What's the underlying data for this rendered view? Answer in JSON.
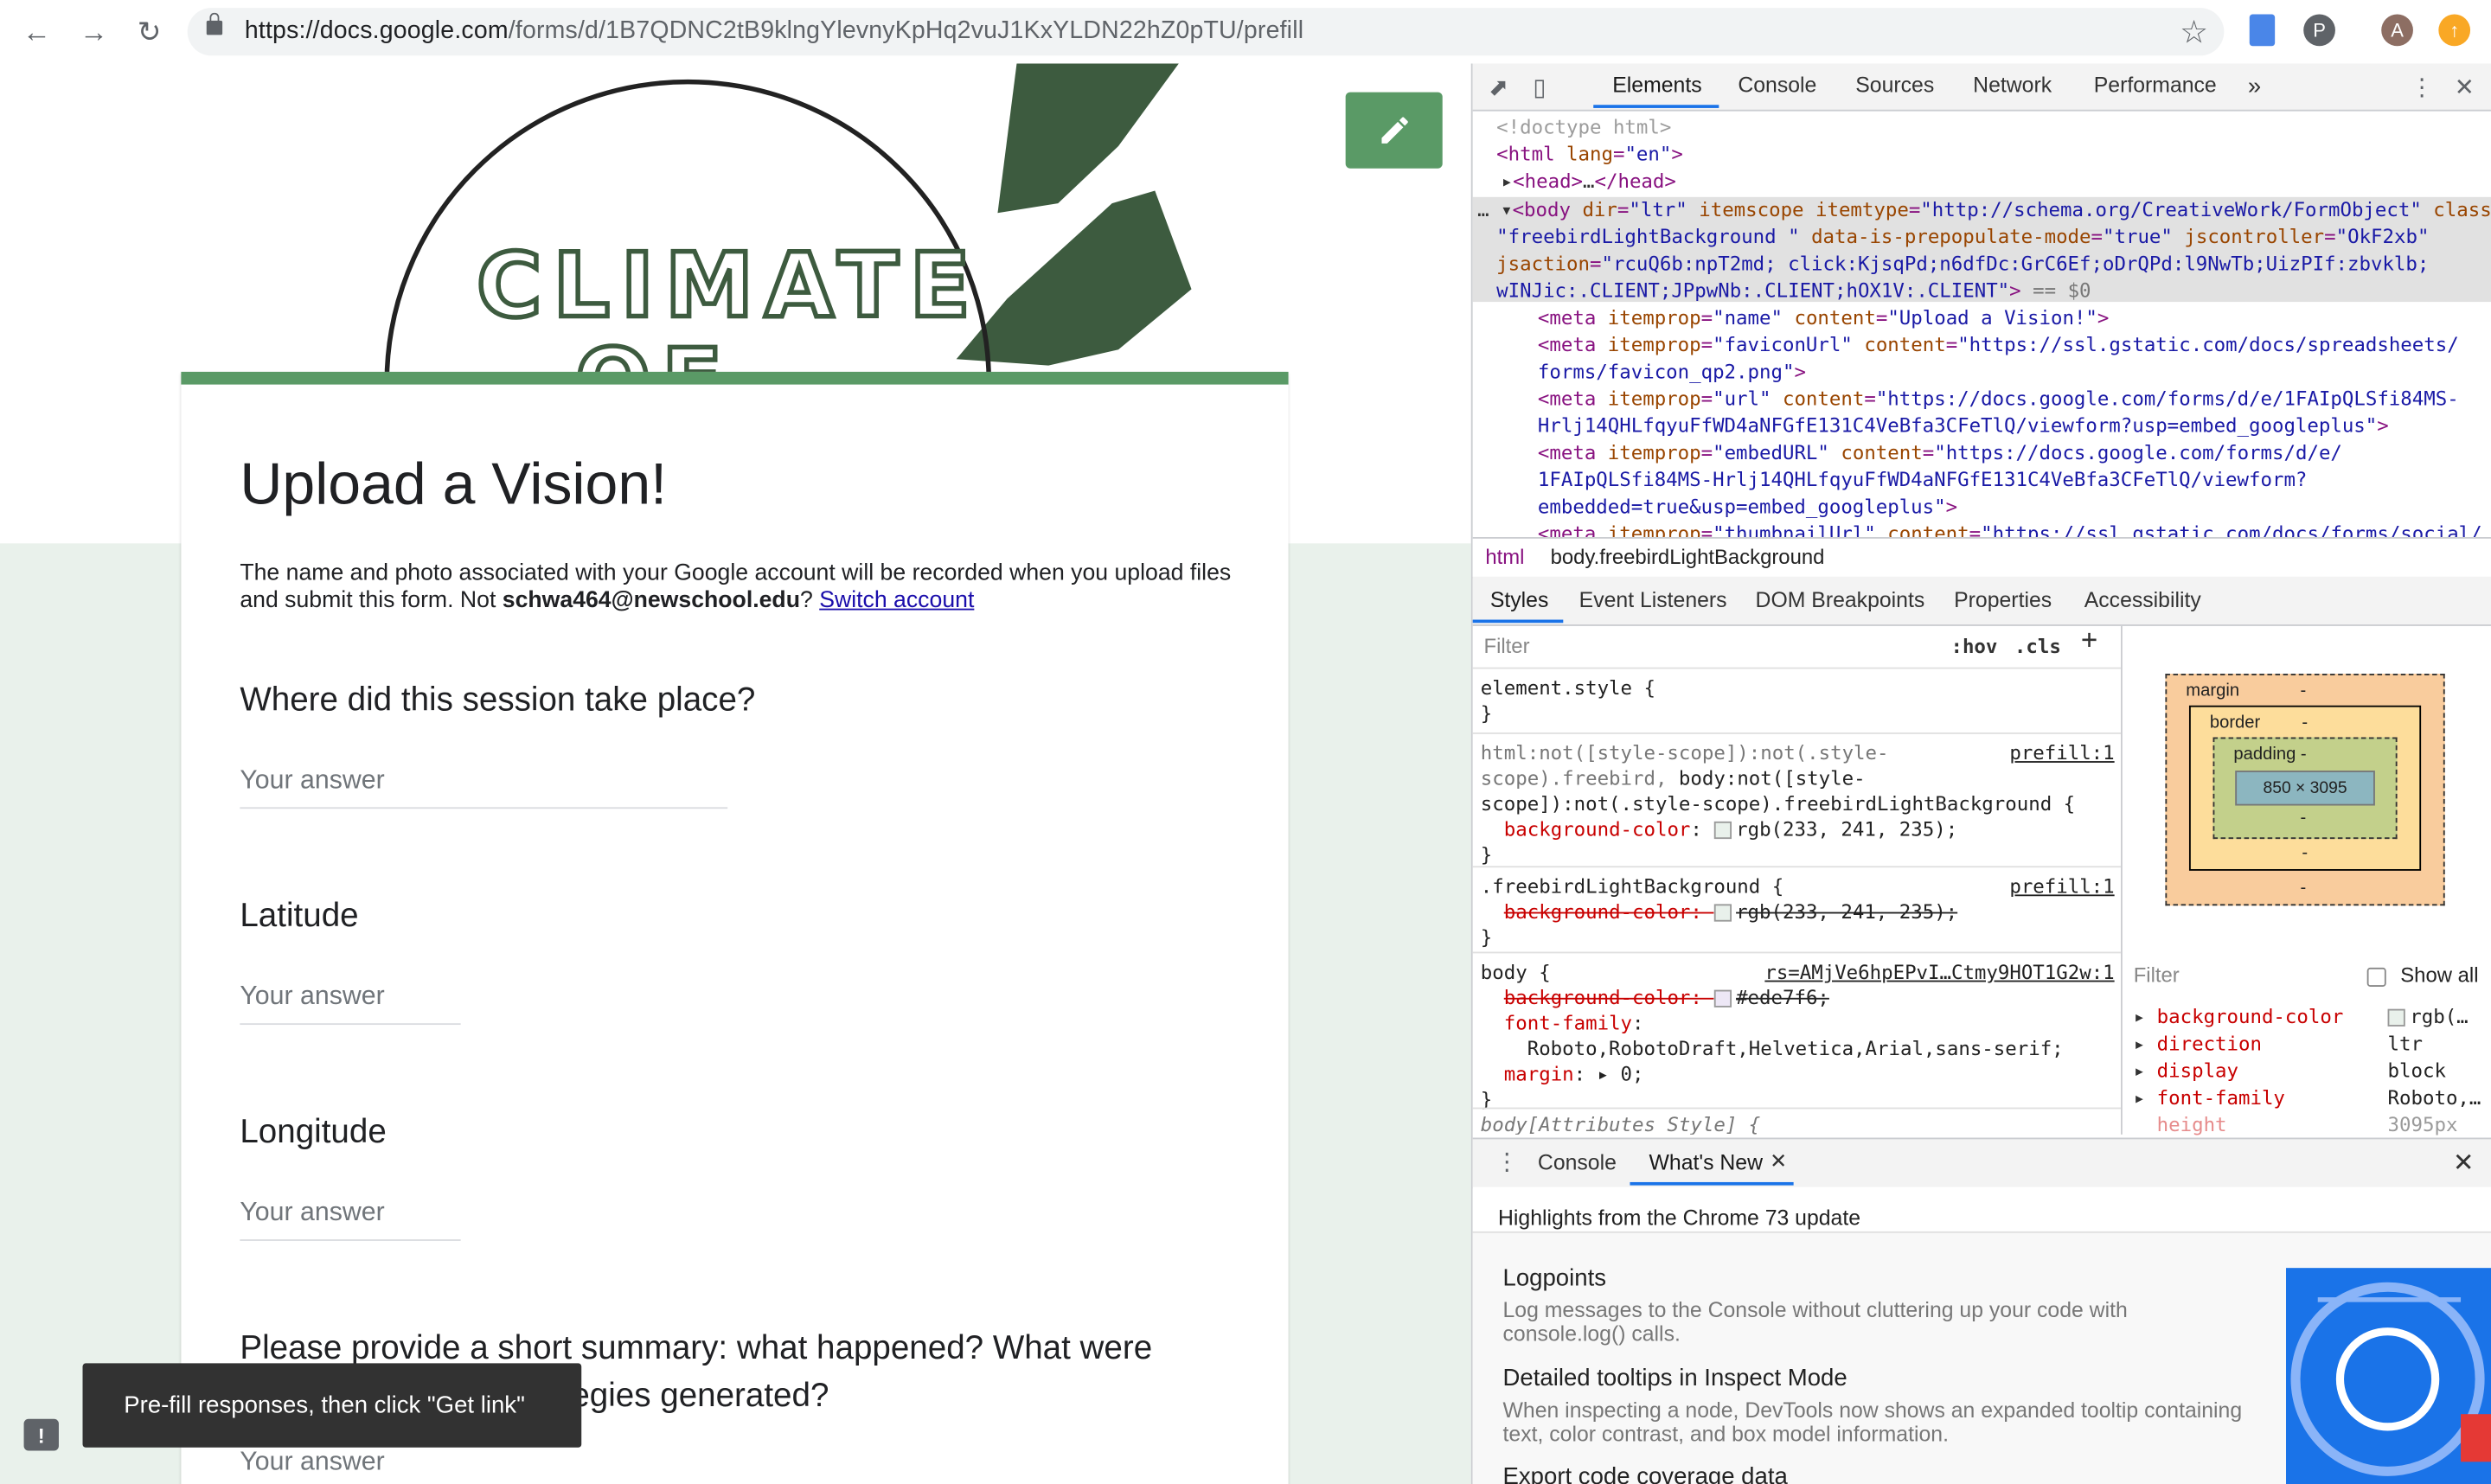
{
  "browser": {
    "url_host": "https://docs.google.com",
    "url_path": "/forms/d/1B7QDNC2tB9klngYlevnyKpHq2vuJ1KxYLDN22hZ0pTU/prefill",
    "avatar_letter": "A"
  },
  "header": {
    "logo_line1": "CLIMATE",
    "logo_line2": "OF"
  },
  "form": {
    "title": "Upload a Vision!",
    "desc_part1": "The name and photo associated with your Google account will be recorded when you upload files and submit this form. Not ",
    "email": "schwa464@newschool.edu",
    "desc_q": "?",
    "switch_account": "Switch account",
    "questions": [
      {
        "label": "Where did this session take place?",
        "placeholder": "Your answer"
      },
      {
        "label": "Latitude",
        "placeholder": "Your answer"
      },
      {
        "label": "Longitude",
        "placeholder": "Your answer"
      },
      {
        "label": "Please provide a short summary: what happened? What were",
        "label2": "ategies generated?",
        "placeholder": "Your answer"
      }
    ]
  },
  "toast": {
    "text": "Pre-fill responses, then click \"Get link\""
  },
  "devtools": {
    "tabs": [
      "Elements",
      "Console",
      "Sources",
      "Network",
      "Performance"
    ],
    "breadcrumbs": [
      "html",
      "body.freebirdLightBackground"
    ],
    "sub_tabs": [
      "Styles",
      "Event Listeners",
      "DOM Breakpoints",
      "Properties",
      "Accessibility"
    ],
    "filter_placeholder": "Filter",
    "hov": ":hov",
    "cls": ".cls",
    "boxmodel": {
      "margin": "margin",
      "border": "border",
      "padding": "padding -",
      "content": "850 × 3095",
      "dash": "-"
    },
    "computed_filter": "Filter",
    "show_all": "Show all",
    "computed": [
      {
        "prop": "background-color",
        "val": "rgb(…"
      },
      {
        "prop": "direction",
        "val": "ltr"
      },
      {
        "prop": "display",
        "val": "block"
      },
      {
        "prop": "font-family",
        "val": "Roboto,…"
      },
      {
        "prop": "height",
        "val": "3095px"
      }
    ],
    "drawer_tabs": [
      "Console",
      "What's New"
    ],
    "whats_new": {
      "heading": "Highlights from the Chrome 73 update",
      "items": [
        {
          "title": "Logpoints",
          "text": "Log messages to the Console without cluttering up your code with console.log() calls."
        },
        {
          "title": "Detailed tooltips in Inspect Mode",
          "text": "When inspecting a node, DevTools now shows an expanded tooltip containing text, color contrast, and box model information."
        },
        {
          "title": "Export code coverage data",
          "text": ""
        }
      ]
    }
  }
}
